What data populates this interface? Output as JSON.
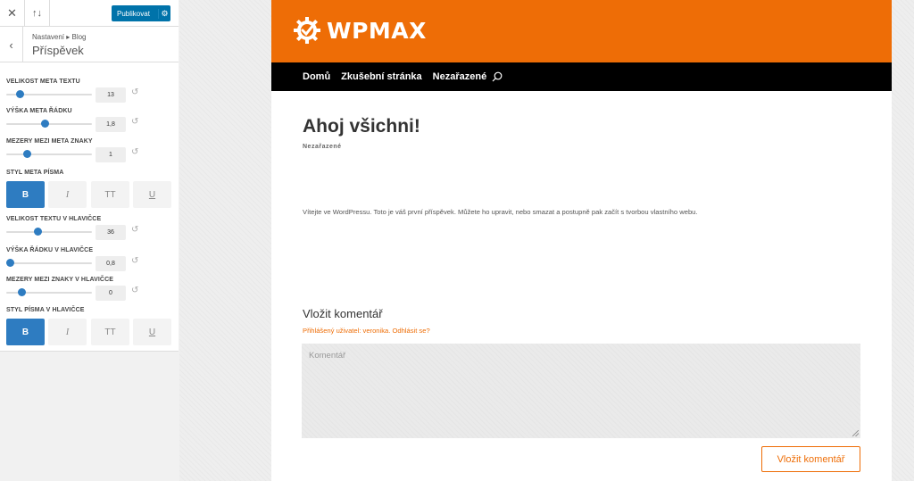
{
  "customizer": {
    "close_icon": "close-icon",
    "reorder_icon": "reorder-icon",
    "publish_label": "Publikovat",
    "publish_icon": "gear-icon",
    "breadcrumb": "Nastavení ▸ Blog",
    "section_title": "Příspěvek",
    "controls": [
      {
        "label": "VELIKOST META TEXTU",
        "value": "13",
        "slider_fraction": 0.13
      },
      {
        "label": "VÝŠKA META ŘÁDKU",
        "value": "1,8",
        "slider_fraction": 0.45
      },
      {
        "label": "MEZERY MEZI META ZNAKY",
        "value": "1",
        "slider_fraction": 0.22
      }
    ],
    "meta_style_label": "STYL META PÍSMA",
    "header_controls": [
      {
        "label": "VELIKOST TEXTU V HLAVIČCE",
        "value": "36",
        "slider_fraction": 0.36
      },
      {
        "label": "VÝŠKA ŘÁDKU V HLAVIČCE",
        "value": "0,8",
        "slider_fraction": 0.0
      },
      {
        "label": "MEZERY MEZI ZNAKY V HLAVIČCE",
        "value": "0",
        "slider_fraction": 0.15
      }
    ],
    "header_style_label": "STYL PÍSMA V HLAVIČCE",
    "style_buttons": [
      "B",
      "I",
      "TT",
      "U"
    ],
    "accent_color": "#2e7cc1"
  },
  "site": {
    "logo_text": "WPMAX",
    "brand_color": "#ee6d06",
    "nav": [
      "Domů",
      "Zkušební stránka",
      "Nezařazené"
    ],
    "post_title": "Ahoj všichni!",
    "post_category": "Nezařazené",
    "post_body": "Vítejte ve WordPressu. Toto je váš první příspěvek. Můžete ho upravit, nebo smazat a postupně pak začít s tvorbou vlastního webu.",
    "comment_heading": "Vložit komentář",
    "logged_in_text": "Přihlášený uživatel: veronika. Odhlásit se?",
    "comment_placeholder": "Komentář",
    "submit_label": "Vložit komentář"
  }
}
